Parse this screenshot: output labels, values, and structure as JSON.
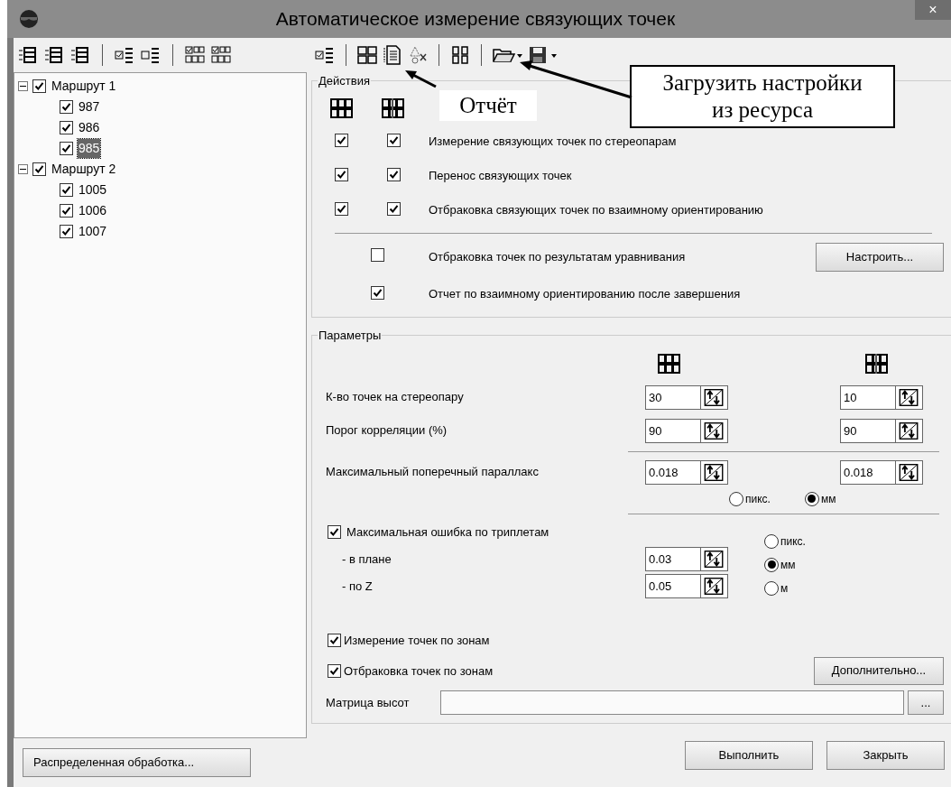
{
  "window": {
    "title": "Автоматическое измерение связующих точек",
    "close": "×"
  },
  "tree": [
    {
      "label": "Маршрут 1",
      "checked": true,
      "expanded": true,
      "selected": false,
      "children": [
        {
          "label": "987",
          "checked": true,
          "selected": false
        },
        {
          "label": "986",
          "checked": true,
          "selected": false
        },
        {
          "label": "985",
          "checked": true,
          "selected": true
        }
      ]
    },
    {
      "label": "Маршрут 2",
      "checked": true,
      "expanded": true,
      "selected": false,
      "children": [
        {
          "label": "1005",
          "checked": true,
          "selected": false
        },
        {
          "label": "1006",
          "checked": true,
          "selected": false
        },
        {
          "label": "1007",
          "checked": true,
          "selected": false
        }
      ]
    }
  ],
  "actions": {
    "title": "Действия",
    "rows": [
      {
        "label": "Измерение связующих точек по стереопарам",
        "checked_a": true,
        "checked_b": true
      },
      {
        "label": "Перенос связующих точек",
        "checked_a": true,
        "checked_b": true
      },
      {
        "label": "Отбраковка связующих точек по взаимному ориентированию",
        "checked_a": true,
        "checked_b": true
      }
    ],
    "extra_rows": [
      {
        "label": "Отбраковка точек по результатам уравнивания",
        "checked": false,
        "button": "Настроить..."
      },
      {
        "label": "Отчет по взаимному ориентированию после завершения",
        "checked": true
      }
    ]
  },
  "params": {
    "title": "Параметры",
    "rows": [
      {
        "label": "К-во точек на стереопару",
        "value_a": "30",
        "value_b": "10"
      },
      {
        "label": "Порог корреляции (%)",
        "value_a": "90",
        "value_b": "90"
      }
    ],
    "parallax": {
      "label": "Максимальный поперечный параллакс",
      "value_a": "0.018",
      "value_b": "0.018",
      "units": [
        {
          "label": "пикс.",
          "selected": false
        },
        {
          "label": "мм",
          "selected": true
        }
      ]
    },
    "triplets": {
      "label": "Максимальная ошибка по триплетам",
      "checked": true,
      "rows": [
        {
          "label": "- в плане",
          "value": "0.03"
        },
        {
          "label": "- по Z",
          "value": "0.05"
        }
      ],
      "units": [
        {
          "label": "пикс.",
          "selected": false
        },
        {
          "label": "мм",
          "selected": true
        },
        {
          "label": "м",
          "selected": false
        }
      ]
    },
    "zones": [
      {
        "label": "Измерение точек по зонам",
        "checked": true
      },
      {
        "label": "Отбраковка точек по зонам",
        "checked": true
      }
    ],
    "more_button": "Дополнительно...",
    "dem": {
      "label": "Матрица высот",
      "browse": "..."
    }
  },
  "buttons": {
    "distributed": "Распределенная обработка...",
    "run": "Выполнить",
    "close": "Закрыть"
  },
  "callouts": [
    {
      "lines": [
        "Отчёт"
      ],
      "boxed": false
    },
    {
      "lines": [
        "Загрузить настройки",
        "из ресурса"
      ],
      "boxed": true
    }
  ]
}
